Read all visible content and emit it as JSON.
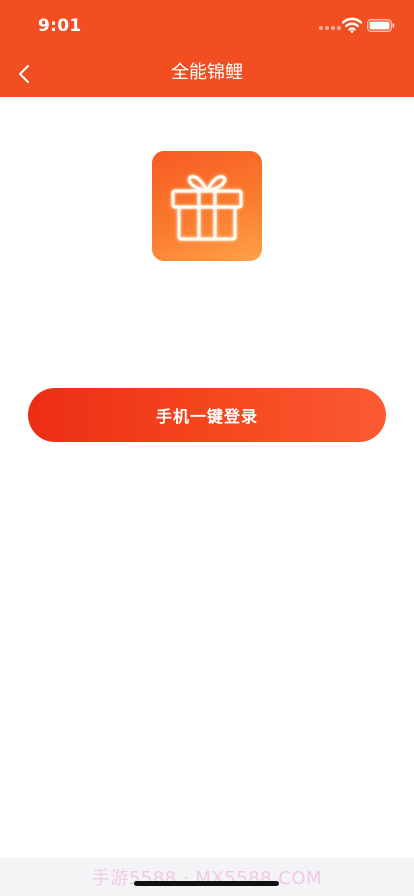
{
  "status_bar": {
    "time": "9:01",
    "icons": [
      "signal-dots-icon",
      "wifi-icon",
      "battery-icon"
    ]
  },
  "nav": {
    "back_icon": "chevron-left-icon",
    "title": "全能锦鲤"
  },
  "app_icon": {
    "icon": "gift-icon"
  },
  "login_button": {
    "label": "手机一键登录"
  },
  "footer": {
    "watermark": "手游5588 · MX5588.COM"
  },
  "colors": {
    "header": "#f34d22",
    "button_start": "#ec2d16",
    "button_end": "#fb5a33",
    "icon_gradient_start": "#f75a24",
    "icon_gradient_end": "#fea14a",
    "background": "#ffffff"
  }
}
